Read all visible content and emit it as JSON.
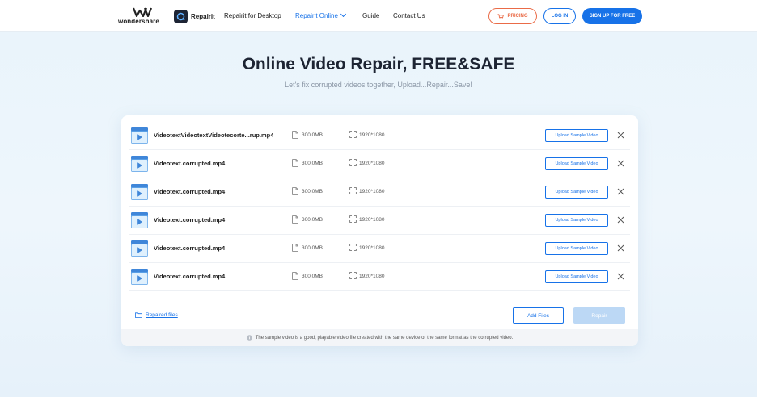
{
  "header": {
    "brand": "wondershare",
    "product": "Repairit",
    "nav": [
      {
        "label": "Repairit for Desktop"
      },
      {
        "label": "Repairit Online",
        "active": true
      },
      {
        "label": "Guide"
      },
      {
        "label": "Contact Us"
      }
    ],
    "pricing_label": "PRICING",
    "login_label": "LOG IN",
    "signup_label": "SIGN UP FOR FREE"
  },
  "hero": {
    "title": "Online Video Repair, FREE&SAFE",
    "subtitle": "Let's fix corrupted videos together, Upload...Repair...Save!"
  },
  "files": [
    {
      "name": "VideotextVideotextVideotecorte...rup.mp4",
      "size": "300.0MB",
      "resolution": "1920*1080",
      "action": "Upload Sample Video"
    },
    {
      "name": "Videotext.corrupted.mp4",
      "size": "300.0MB",
      "resolution": "1920*1080",
      "action": "Upload Sample Video"
    },
    {
      "name": "Videotext.corrupted.mp4",
      "size": "300.0MB",
      "resolution": "1920*1080",
      "action": "Upload Sample Video"
    },
    {
      "name": "Videotext.corrupted.mp4",
      "size": "300.0MB",
      "resolution": "1920*1080",
      "action": "Upload Sample Video"
    },
    {
      "name": "Videotext.corrupted.mp4",
      "size": "300.0MB",
      "resolution": "1920*1080",
      "action": "Upload Sample Video"
    },
    {
      "name": "Videotext.corrupted.mp4",
      "size": "300.0MB",
      "resolution": "1920*1080",
      "action": "Upload Sample Video"
    }
  ],
  "footer": {
    "repaired_files_label": "Repaired files",
    "add_files_label": "Add Files",
    "repair_label": "Repair",
    "note": "The sample video is a good, playable video file created with the same device or the same format as the corrupted video."
  },
  "icons": {
    "video": "video-file-icon",
    "file": "file-icon",
    "resolution": "resolution-icon",
    "close": "close-icon",
    "folder": "folder-icon",
    "info": "info-icon",
    "cart": "cart-icon"
  },
  "colors": {
    "accent": "#1772e8",
    "pricing": "#ea6b47",
    "repair_disabled": "#bcd8f5",
    "title": "#1d2433"
  }
}
